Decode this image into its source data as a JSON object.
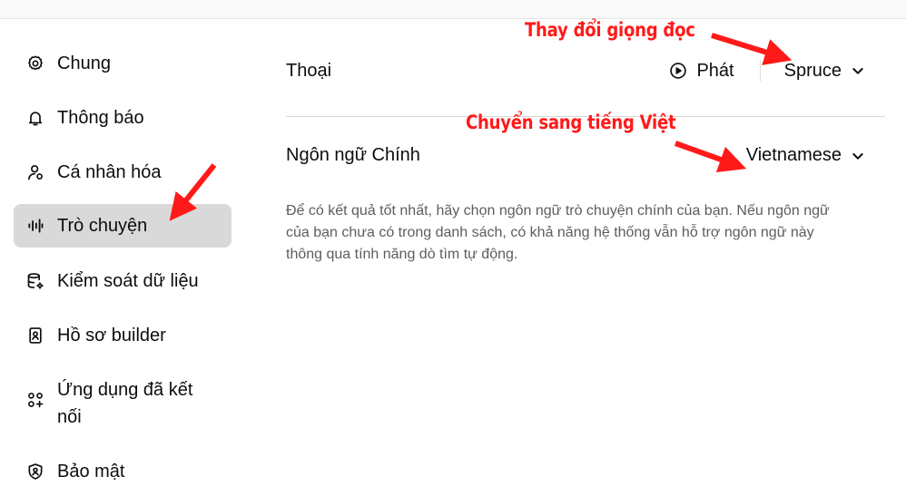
{
  "sidebar": {
    "items": [
      {
        "label": "Chung",
        "icon": "gear-icon"
      },
      {
        "label": "Thông báo",
        "icon": "bell-icon"
      },
      {
        "label": "Cá nhân hóa",
        "icon": "user-personalize-icon"
      },
      {
        "label": "Trò chuyện",
        "icon": "voice-waveform-icon",
        "active": true
      },
      {
        "label": "Kiểm soát dữ liệu",
        "icon": "database-gear-icon"
      },
      {
        "label": "Hồ sơ builder",
        "icon": "id-badge-icon"
      },
      {
        "label": "Ứng dụng đã kết nối",
        "icon": "apps-plus-icon"
      },
      {
        "label": "Bảo mật",
        "icon": "shield-icon"
      }
    ]
  },
  "voice": {
    "label": "Thoại",
    "play_label": "Phát",
    "selected": "Spruce"
  },
  "language": {
    "label": "Ngôn ngữ Chính",
    "selected": "Vietnamese",
    "description": "Để có kết quả tốt nhất, hãy chọn ngôn ngữ trò chuyện chính của bạn. Nếu ngôn ngữ của bạn chưa có trong danh sách, có khả năng hệ thống vẫn hỗ trợ ngôn ngữ này thông qua tính năng dò tìm tự động."
  },
  "annotations": {
    "change_voice": "Thay đổi giọng đọc",
    "switch_language": "Chuyển sang tiếng Việt"
  },
  "colors": {
    "annotation_red": "#ff1a1a",
    "active_bg": "#d9d9d9",
    "text": "#0d0d0d",
    "muted": "#5d5d5d"
  }
}
